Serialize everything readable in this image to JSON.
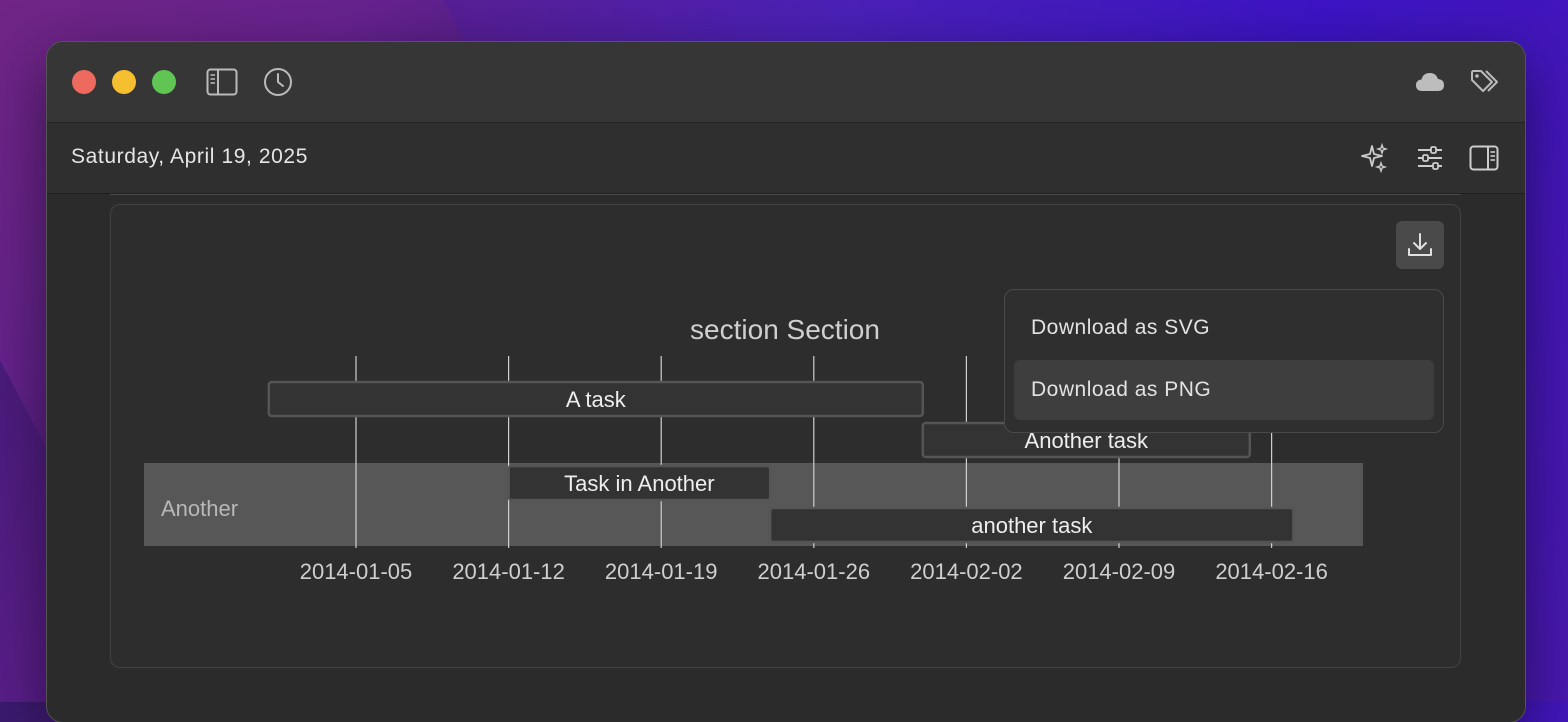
{
  "header": {
    "date": "Saturday, April 19, 2025"
  },
  "icons": {
    "sidebar": "sidebar-icon",
    "history": "clock-icon",
    "cloud": "cloud-icon",
    "tags": "tags-icon",
    "sparkles": "sparkles-icon",
    "sliders": "sliders-icon",
    "right_panel": "right-sidebar-icon",
    "download": "download-icon"
  },
  "download_menu": {
    "items": [
      "Download as SVG",
      "Download as PNG"
    ],
    "highlighted": "Download as PNG"
  },
  "colors": {
    "bar_fill": "#333333",
    "bar_stroke": "#555555",
    "section_band": "#575757",
    "grid": "#cfcfcf"
  },
  "chart_data": {
    "type": "gantt",
    "title": "section Section",
    "sections": [
      "Another"
    ],
    "x_ticks": [
      "2014-01-05",
      "2014-01-12",
      "2014-01-19",
      "2014-01-26",
      "2014-02-02",
      "2014-02-09",
      "2014-02-16"
    ],
    "x_range": [
      "2014-01-01",
      "2014-02-19"
    ],
    "tasks": [
      {
        "label": "A task",
        "section": "Section",
        "start": "2014-01-01",
        "end": "2014-01-31"
      },
      {
        "label": "Another task",
        "section": "Section",
        "start": "2014-01-31",
        "end": "2014-02-15"
      },
      {
        "label": "Task in Another",
        "section": "Another",
        "start": "2014-01-12",
        "end": "2014-01-24"
      },
      {
        "label": "another task",
        "section": "Another",
        "start": "2014-01-24",
        "end": "2014-02-17"
      }
    ]
  }
}
